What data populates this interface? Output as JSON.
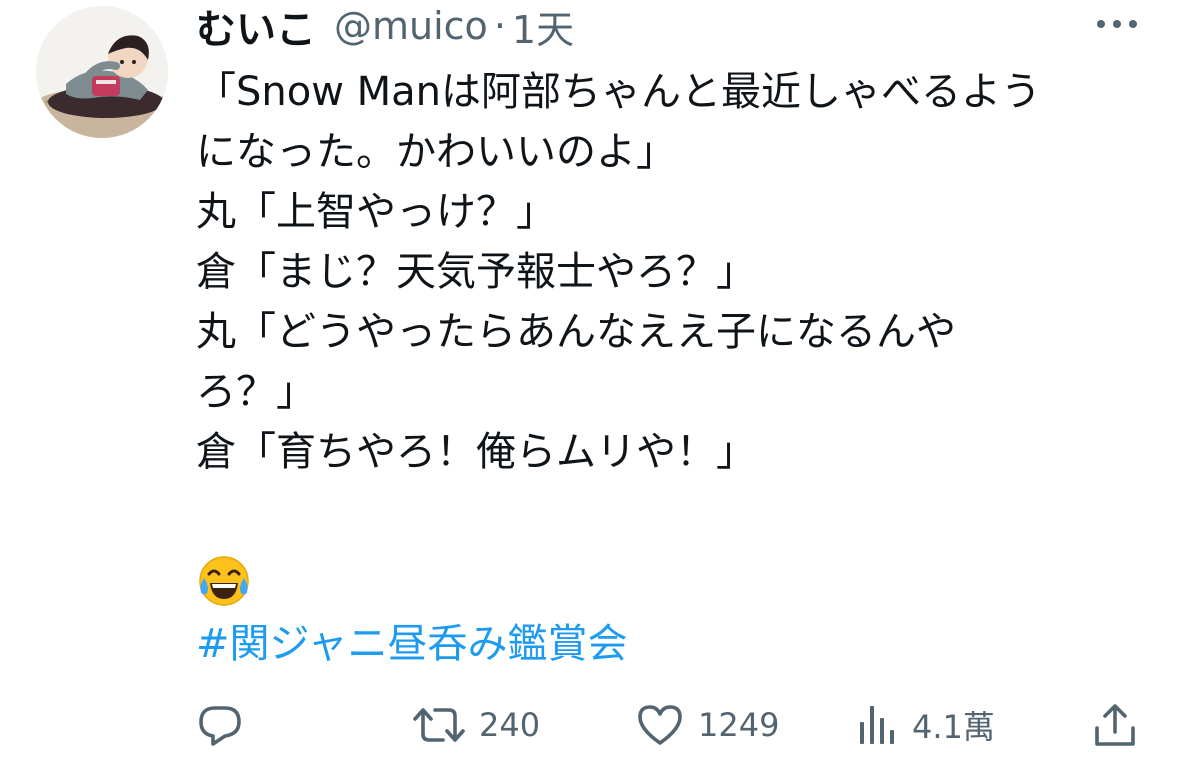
{
  "tweet": {
    "author": {
      "display_name": "むいこ",
      "handle": "@muico",
      "separator": "·",
      "time": "1天"
    },
    "lines": [
      "「Snow Manは阿部ちゃんと最近しゃべるよう",
      "になった。かわいいのよ」",
      "丸「上智やっけ？」",
      "倉「まじ？天気予報士やろ？」",
      "丸「どうやったらあんなええ子になるんや",
      "ろ？」",
      "倉「育ちやろ！俺らムリや！」"
    ],
    "emoji": "face-with-tears-of-joy",
    "hashtag": "#関ジャニ昼呑み鑑賞会",
    "actions": {
      "reply": {
        "icon": "reply-icon"
      },
      "retweet": {
        "icon": "retweet-icon",
        "count": "240"
      },
      "like": {
        "icon": "heart-icon",
        "count": "1249"
      },
      "views": {
        "icon": "views-icon",
        "count": "4.1萬"
      },
      "share": {
        "icon": "share-icon"
      }
    }
  },
  "colors": {
    "text": "#0f1419",
    "secondary": "#536471",
    "link": "#1d9bf0",
    "background": "#ffffff"
  }
}
